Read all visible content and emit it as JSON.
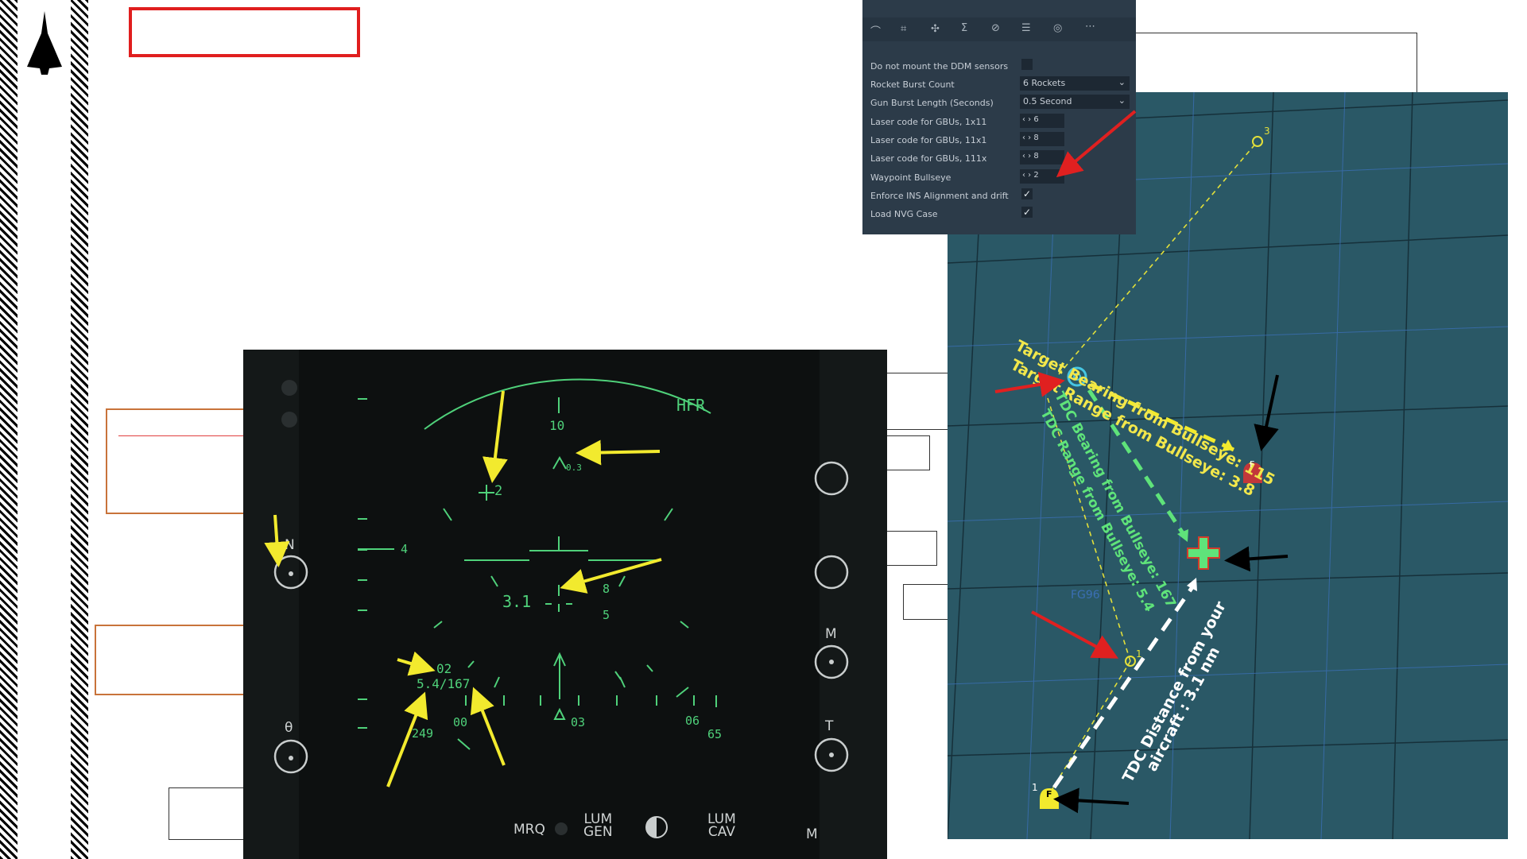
{
  "sidebar": {
    "logo_icon": "delta-jet-icon"
  },
  "settings_panel": {
    "toolbar_icons": [
      "route-icon",
      "frame-icon",
      "drone-icon",
      "sigma-icon",
      "circle-slash-icon",
      "list-icon",
      "radio-icon",
      "more-icon"
    ],
    "rows": [
      {
        "label": "Do not mount the DDM sensors",
        "type": "checkbox",
        "checked": false
      },
      {
        "label": "Rocket Burst Count",
        "type": "select",
        "value": "6 Rockets"
      },
      {
        "label": "Gun Burst Length (Seconds)",
        "type": "select",
        "value": "0.5 Second"
      },
      {
        "label": "Laser code for GBUs, 1x11",
        "type": "spinner",
        "value": "6"
      },
      {
        "label": "Laser code for GBUs, 11x1",
        "type": "spinner",
        "value": "8"
      },
      {
        "label": "Laser code for GBUs, 111x",
        "type": "spinner",
        "value": "8"
      },
      {
        "label": "Waypoint Bullseye",
        "type": "spinner",
        "value": "2"
      },
      {
        "label": "Enforce INS Alignment and drift",
        "type": "checkbox",
        "checked": true
      },
      {
        "label": "Load NVG Case",
        "type": "checkbox",
        "checked": true
      }
    ]
  },
  "mfd": {
    "mode": "HFR",
    "heading_scale_top": "10",
    "waypoint_marker": "+2",
    "caret_value": "0.3",
    "scale_left": "4",
    "tdc_distance": "3.1",
    "right_val_1": "8",
    "right_val_2": "5",
    "bullseye_id": "02",
    "bullseye_readout": "5.4/167",
    "bottom_249": "249",
    "bottom_00": "00",
    "bottom_03": "03",
    "bottom_06": "06",
    "bottom_65": "65",
    "left_label_n": "N",
    "left_label_theta": "θ",
    "right_label_m": "M",
    "right_label_t": "T",
    "right_label_m2": "M",
    "bottom_mrq": "MRQ",
    "bottom_lum_gen_1": "LUM",
    "bottom_lum_gen_2": "GEN",
    "bottom_lum_cav_1": "LUM",
    "bottom_lum_cav_2": "CAV"
  },
  "map": {
    "target_bearing": "Target Bearing from Bullseye: 115",
    "target_range": "Target Range from Bullseye: 3.8",
    "tdc_bearing": "TDC Bearing from Bullseye: 167",
    "tdc_range": "TDC Range from Bullseye: 5.4",
    "tdc_distance_1": "TDC Distance from your",
    "tdc_distance_2": "aircraft : 3.1 nm",
    "grid_label": "FG96",
    "wp3": "3",
    "wp1a": "1",
    "wp1b": "1",
    "f_marker": "F",
    "colors": {
      "target_text": "#f2e74b",
      "tdc_text": "#5fe37a",
      "map_bg": "#2a5866",
      "mfd_green": "#4fd17a",
      "arrow_yellow": "#f2ea2e",
      "arrow_red": "#e02020"
    }
  }
}
